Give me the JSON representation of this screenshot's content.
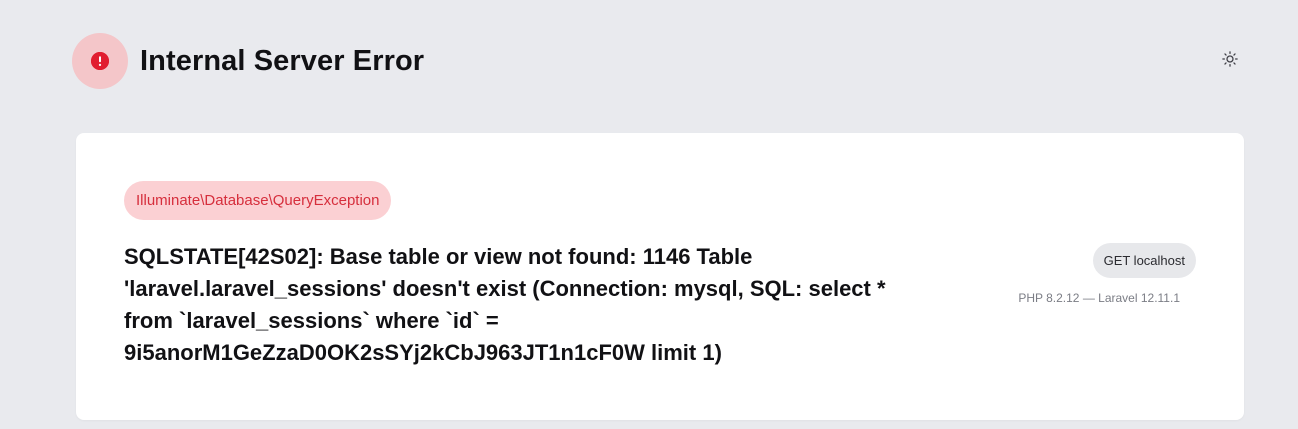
{
  "header": {
    "title": "Internal Server Error",
    "status_icon": "exclamation-circle-icon",
    "theme_icon": "sun-icon"
  },
  "colors": {
    "background": "#e9eaee",
    "card": "#ffffff",
    "error_red": "#e11d2f",
    "error_badge_bg": "#f4c6c9",
    "exception_pill_bg": "#fbd0d3",
    "exception_pill_text": "#d62e3c",
    "request_pill_bg": "#e7e8eb",
    "muted_text": "#7b7d85"
  },
  "exception": {
    "class_name": "Illuminate\\Database\\QueryException",
    "message": "SQLSTATE[42S02]: Base table or view not found: 1146 Table 'laravel.laravel_sessions' doesn't exist (Connection: mysql, SQL: select * from `laravel_sessions` where `id` = 9i5anorM1GeZzaD0OK2sSYj2kCbJ963JT1n1cF0W limit 1)"
  },
  "request": {
    "label": "GET localhost"
  },
  "environment": {
    "versions": "PHP 8.2.12 — Laravel 12.11.1"
  }
}
